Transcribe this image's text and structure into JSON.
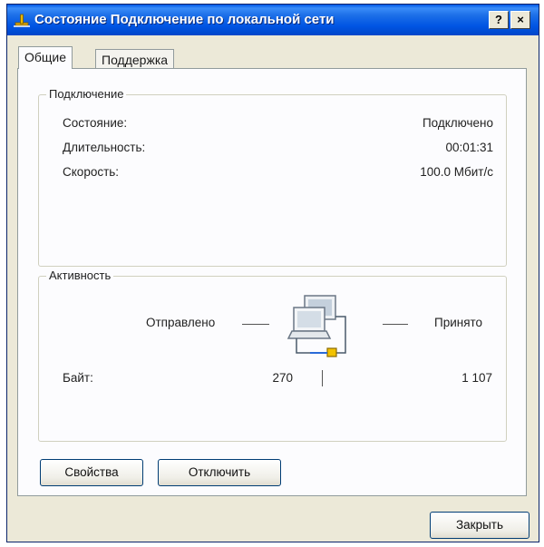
{
  "window": {
    "title": "Состояние Подключение по локальной сети",
    "help_label": "?",
    "close_label": "×"
  },
  "tabs": [
    {
      "label": "Общие",
      "active": true
    },
    {
      "label": "Поддержка",
      "active": false
    }
  ],
  "connection": {
    "legend": "Подключение",
    "rows": [
      {
        "label": "Состояние:",
        "value": "Подключено"
      },
      {
        "label": "Длительность:",
        "value": "00:01:31"
      },
      {
        "label": "Скорость:",
        "value": "100.0 Мбит/с"
      }
    ]
  },
  "activity": {
    "legend": "Активность",
    "sent_label": "Отправлено",
    "received_label": "Принято",
    "bytes_label": "Байт:",
    "bytes_sent": "270",
    "bytes_received": "1 107",
    "icon": "network-computers-icon"
  },
  "buttons": {
    "properties": "Свойства",
    "disable": "Отключить",
    "close": "Закрыть"
  },
  "colors": {
    "titlebar": "#0054e3",
    "dialog_bg": "#ece9d8",
    "panel_bg": "#fcfcfe"
  }
}
